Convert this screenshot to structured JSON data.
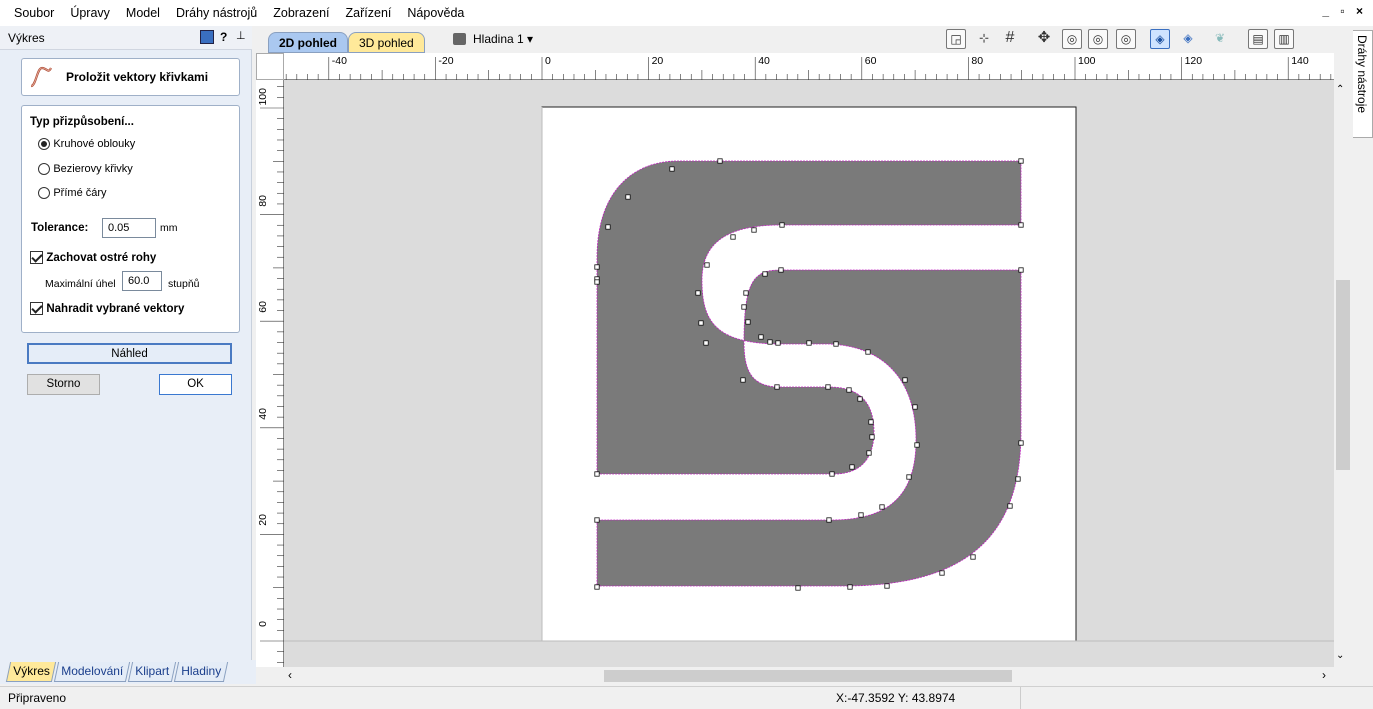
{
  "menu": [
    "Soubor",
    "Úpravy",
    "Model",
    "Dráhy nástrojů",
    "Zobrazení",
    "Zařízení",
    "Nápověda"
  ],
  "window_controls": "_ ▫ ×",
  "panel": {
    "title": "Výkres",
    "help": "?",
    "pin": "⊥",
    "tool_title": "Proložit vektory křivkami",
    "fit_type_label": "Typ přizpůsobení...",
    "fit_options": [
      "Kruhové oblouky",
      "Bezierovy křivky",
      "Přímé čáry"
    ],
    "tolerance_label": "Tolerance:",
    "tolerance_value": "0.05",
    "tolerance_unit": "mm",
    "keep_corners_label": "Zachovat ostré rohy",
    "max_angle_label": "Maximální úhel",
    "max_angle_value": "60.0",
    "max_angle_unit": "stupňů",
    "replace_label": "Nahradit vybrané vektory",
    "preview_button": "Náhled",
    "cancel_button": "Storno",
    "ok_button": "OK"
  },
  "bottom_tabs": [
    "Výkres",
    "Modelování",
    "Klipart",
    "Hladiny"
  ],
  "view_tabs": {
    "view2d": "2D pohled",
    "view3d": "3D pohled"
  },
  "layer_label": "Hladina 1 ▾",
  "ruler_top_labels": [
    "-40",
    "-20",
    "0",
    "20",
    "40",
    "60",
    "80",
    "100",
    "120",
    "140"
  ],
  "ruler_left_labels": [
    "100",
    "80",
    "60",
    "40",
    "20",
    "0"
  ],
  "right_dock_label": "Dráhy nástroje",
  "status": {
    "left": "Připraveno",
    "coords": "X:-47.3592 Y: 43.8974"
  },
  "colors": {
    "shape_fill": "#7a7a7a",
    "vector_outline": "#c020c0",
    "tab_active": "#ffe99a",
    "tab_2d": "#aac8f0",
    "canvas_bg": "#dcdcdc"
  },
  "icons": [
    "select-vectors-icon",
    "node-edit-icon",
    "grid-icon",
    "pan-icon",
    "zoom-box-icon",
    "zoom-fit-icon",
    "zoom-icon",
    "vector-fit-icon",
    "vector-snap-icon",
    "toolpath-preview-icon",
    "layout-horizontal-icon",
    "layout-vertical-icon"
  ]
}
